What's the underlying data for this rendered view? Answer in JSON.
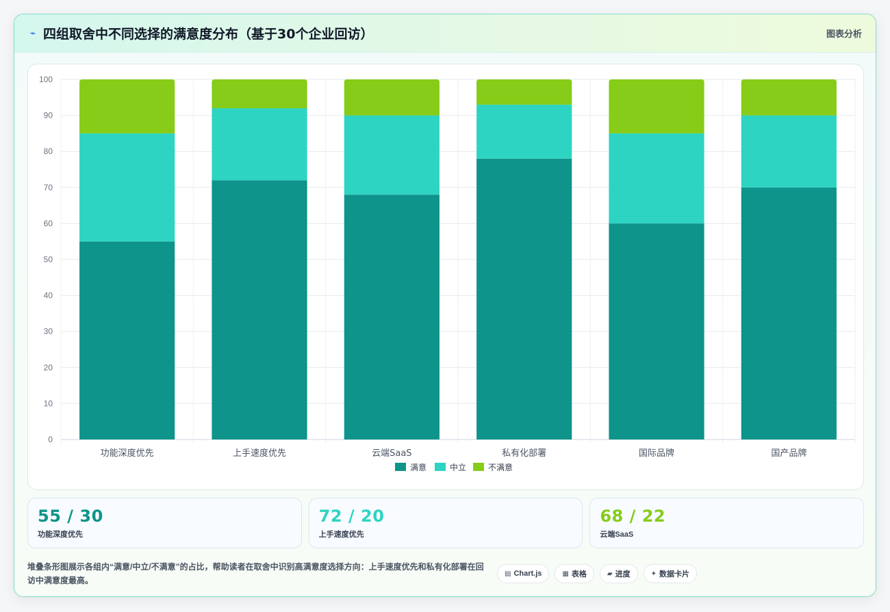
{
  "header": {
    "title": "四组取舍中不同选择的满意度分布（基于30个企业回访）",
    "tag": "图表分析",
    "icon": "lightning-icon"
  },
  "colors": {
    "satisfied": "#0e948a",
    "neutral": "#2ed4c2",
    "unsatisfied": "#86cc18"
  },
  "chart_data": {
    "type": "bar",
    "stacked": true,
    "categories": [
      "功能深度优先",
      "上手速度优先",
      "云端SaaS",
      "私有化部署",
      "国际品牌",
      "国产品牌"
    ],
    "series": [
      {
        "name": "满意",
        "values": [
          55,
          72,
          68,
          78,
          60,
          70
        ]
      },
      {
        "name": "中立",
        "values": [
          30,
          20,
          22,
          15,
          25,
          20
        ]
      },
      {
        "name": "不满意",
        "values": [
          15,
          8,
          10,
          7,
          15,
          10
        ]
      }
    ],
    "ylim": [
      0,
      100
    ],
    "yticks": [
      0,
      10,
      20,
      30,
      40,
      50,
      60,
      70,
      80,
      90,
      100
    ],
    "legend": "bottom",
    "grid": true
  },
  "stats": [
    {
      "value": "55 / 30",
      "label": "功能深度优先",
      "color": "#0e948a"
    },
    {
      "value": "72 / 20",
      "label": "上手速度优先",
      "color": "#2ed4c2"
    },
    {
      "value": "68 / 22",
      "label": "云端SaaS",
      "color": "#86cc18"
    }
  ],
  "footer": {
    "text": "堆叠条形图展示各组内“满意/中立/不满意”的占比，帮助读者在取舍中识别高满意度选择方向：上手速度优先和私有化部署在回访中满意度最高。",
    "chips": [
      {
        "icon": "▤",
        "label": "Chart.js"
      },
      {
        "icon": "▦",
        "label": "表格"
      },
      {
        "icon": "▰",
        "label": "进度"
      },
      {
        "icon": "✦",
        "label": "数据卡片"
      }
    ]
  }
}
